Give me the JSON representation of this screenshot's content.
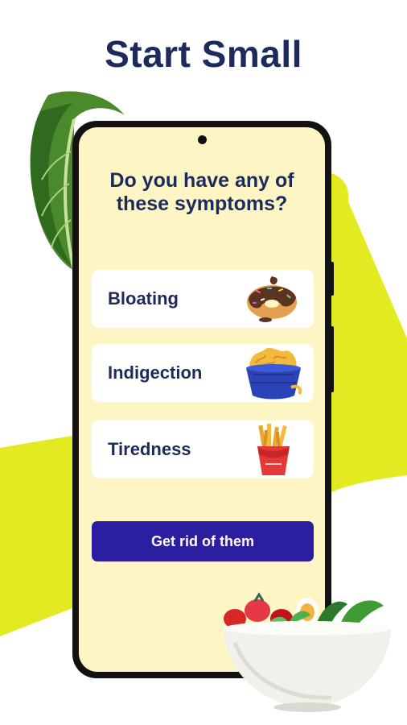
{
  "header": {
    "title": "Start Small"
  },
  "screen": {
    "question": "Do you have any of these symptoms?",
    "options": [
      {
        "label": "Bloating",
        "icon": "donut-icon"
      },
      {
        "label": "Indigection",
        "icon": "mac-and-cheese-icon"
      },
      {
        "label": "Tiredness",
        "icon": "french-fries-icon"
      }
    ],
    "cta_label": "Get rid of them"
  },
  "colors": {
    "title": "#1c2a5c",
    "screen_background": "#fdf5c4",
    "cta_background": "#2c1ea0",
    "accent_wave": "#e4ea22"
  }
}
